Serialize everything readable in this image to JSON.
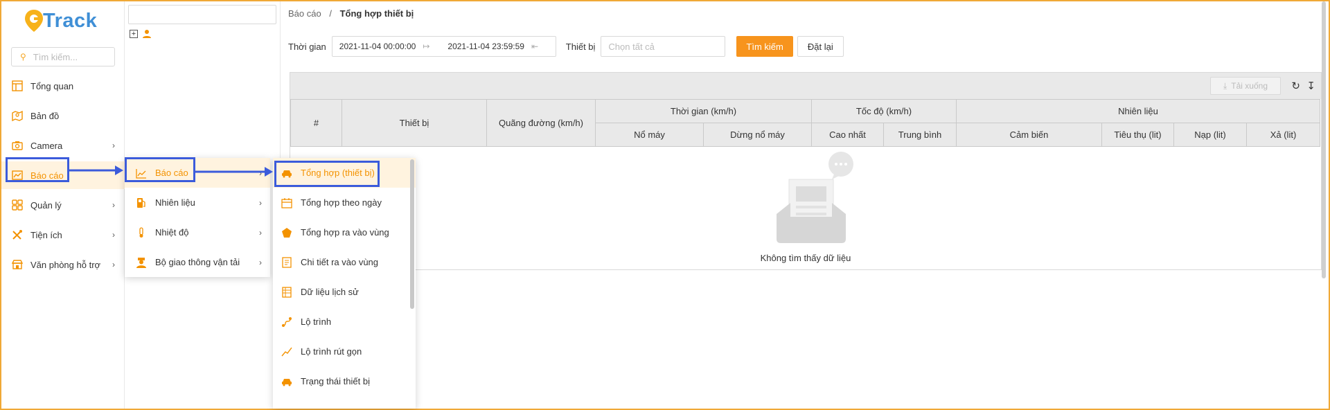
{
  "brand": {
    "logo_text": "Track",
    "logo_letter": "G"
  },
  "sidebar": {
    "search_placeholder": "Tìm kiếm...",
    "items": [
      {
        "label": "Tổng quan",
        "icon": "layout-icon",
        "has_children": false
      },
      {
        "label": "Bản đồ",
        "icon": "map-icon",
        "has_children": false
      },
      {
        "label": "Camera",
        "icon": "camera-icon",
        "has_children": true
      },
      {
        "label": "Báo cáo",
        "icon": "chart-icon",
        "has_children": true,
        "active": true
      },
      {
        "label": "Quản lý",
        "icon": "grid-icon",
        "has_children": true
      },
      {
        "label": "Tiện ích",
        "icon": "tools-icon",
        "has_children": true
      },
      {
        "label": "Văn phòng hỗ trợ",
        "icon": "store-icon",
        "has_children": true
      }
    ]
  },
  "report_menu": {
    "items": [
      {
        "label": "Báo cáo",
        "icon": "line-chart-icon",
        "active": true
      },
      {
        "label": "Nhiên liệu",
        "icon": "fuel-icon"
      },
      {
        "label": "Nhiệt độ",
        "icon": "thermometer-icon"
      },
      {
        "label": "Bộ giao thông vận tải",
        "icon": "officer-icon"
      }
    ]
  },
  "report_submenu": {
    "items": [
      {
        "label": "Tổng hợp (thiết bị)",
        "icon": "car-icon",
        "active": true
      },
      {
        "label": "Tổng hợp theo ngày",
        "icon": "calendar-icon"
      },
      {
        "label": "Tổng hợp ra vào vùng",
        "icon": "pentagon-icon"
      },
      {
        "label": "Chi tiết ra vào vùng",
        "icon": "document-icon"
      },
      {
        "label": "Dữ liệu lịch sử",
        "icon": "list-icon"
      },
      {
        "label": "Lộ trình",
        "icon": "route-icon"
      },
      {
        "label": "Lộ trình rút gọn",
        "icon": "trend-icon"
      },
      {
        "label": "Trạng thái thiết bị",
        "icon": "car-icon"
      }
    ]
  },
  "breadcrumb": {
    "parent": "Báo cáo",
    "separator": "/",
    "current": "Tổng hợp thiết bị"
  },
  "filters": {
    "time_label": "Thời gian",
    "start": "2021-11-04 00:00:00",
    "end": "2021-11-04 23:59:59",
    "device_label": "Thiết bị",
    "device_placeholder": "Chọn tất cả",
    "search_button": "Tìm kiếm",
    "reset_button": "Đặt lại"
  },
  "table": {
    "download_label": "Tải xuống",
    "headers": {
      "index": "#",
      "device": "Thiết bị",
      "distance": "Quãng đường (km/h)",
      "time_group": "Thời gian (km/h)",
      "engine_on": "Nổ máy",
      "engine_idle": "Dừng nổ máy",
      "speed_group": "Tốc độ (km/h)",
      "max": "Cao nhất",
      "avg": "Trung bình",
      "fuel_group": "Nhiên liệu",
      "sensor": "Cảm biến",
      "consume": "Tiêu thụ (lit)",
      "refill": "Nạp (lit)",
      "discharge": "Xả (lit)"
    },
    "empty_text": "Không tìm thấy dữ liệu"
  },
  "colors": {
    "accent": "#f7941d",
    "highlight": "#3b5bdb",
    "brand_blue": "#3f8fd6"
  }
}
